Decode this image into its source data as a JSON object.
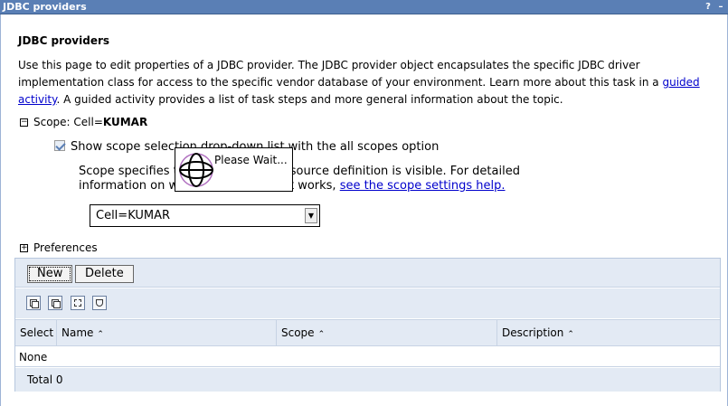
{
  "window": {
    "title": "JDBC providers",
    "help_label": "?",
    "minimize_label": "–"
  },
  "page": {
    "heading": "JDBC providers",
    "intro_part1": "Use this page to edit properties of a JDBC provider. The JDBC provider object encapsulates the specific JDBC driver implementation class for access to the specific vendor database of your environment. Learn more about this task in a ",
    "intro_link": "guided activity",
    "intro_part2": ". A guided activity provides a list of task steps and more general information about the topic."
  },
  "scope": {
    "toggle": "−",
    "label": "Scope: Cell=",
    "cell": "KUMAR",
    "checkbox_label": "Show scope selection drop-down list with the all scopes option",
    "checked": true,
    "desc_part1": "Scope specifies t",
    "desc_part2": "resource definition is visible. For detailed",
    "desc_part3": "information on wh",
    "desc_part4": "it works, ",
    "desc_link": "see the scope settings help.",
    "select_value": "Cell=KUMAR"
  },
  "popup": {
    "text": "Please Wait..."
  },
  "preferences": {
    "toggle": "+",
    "label": "Preferences"
  },
  "toolbar": {
    "new_label": "New",
    "delete_label": "Delete"
  },
  "table": {
    "columns": [
      "Select",
      "Name",
      "Scope",
      "Description"
    ],
    "sort_glyph": "⌃⌄",
    "empty_text": "None",
    "total": "Total 0"
  },
  "colors": {
    "title_bar": "#5a7fb5",
    "panel_bg": "#e3eaf4",
    "link": "#0000cc"
  }
}
